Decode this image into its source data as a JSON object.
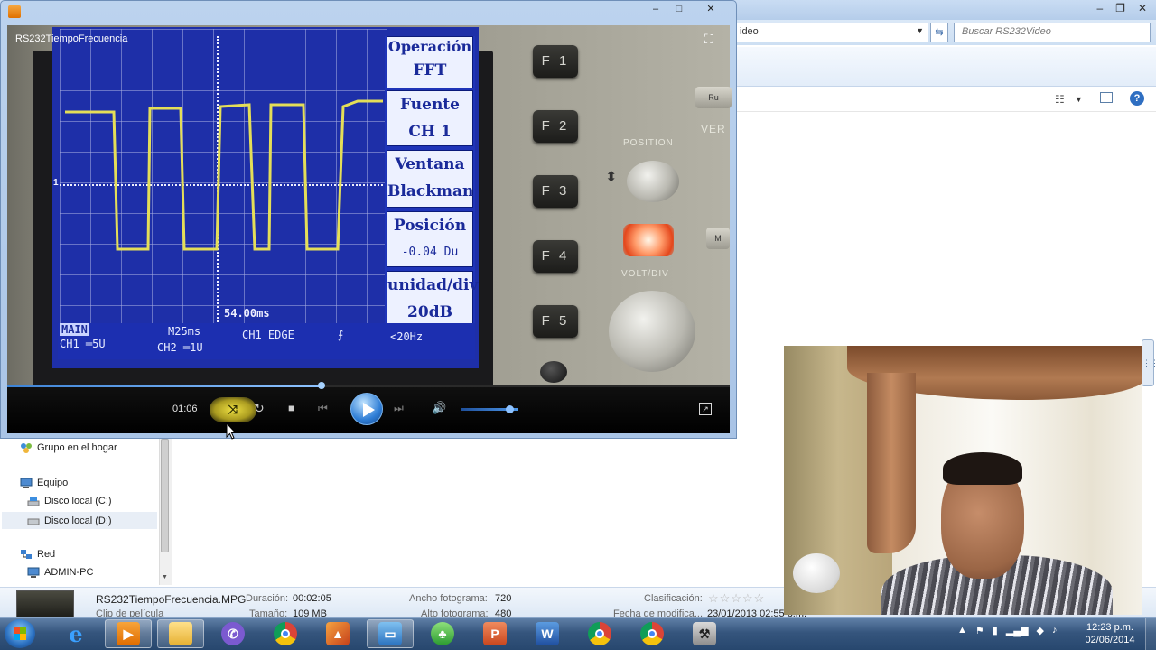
{
  "explorer": {
    "address_text": "ideo",
    "search_placeholder": "Buscar RS232Video",
    "nav": {
      "homegroup": "Grupo en el hogar",
      "computer": "Equipo",
      "disk_c": "Disco local (C:)",
      "disk_d": "Disco local (D:)",
      "network": "Red",
      "admin_pc": "ADMIN-PC"
    },
    "details": {
      "file_name": "RS232TiempoFrecuencia.MPG",
      "file_type": "Clip de película",
      "duration_label": "Duración:",
      "duration_value": "00:02:05",
      "size_label": "Tamaño:",
      "size_value": "109 MB",
      "frame_width_label": "Ancho fotograma:",
      "frame_width_value": "720",
      "frame_height_label": "Alto fotograma:",
      "frame_height_value": "480",
      "rating_label": "Clasificación:",
      "rating_stars": "☆☆☆☆☆",
      "modified_label": "Fecha de modifica...",
      "modified_value": "23/01/2013 02:55 p.m."
    }
  },
  "player": {
    "title": "RS232TiempoFrecuencia",
    "current_time": "01:06",
    "progress_fraction": 0.53,
    "volume_fraction": 0.85
  },
  "scope": {
    "menu": [
      {
        "line1": "Operación",
        "line2": "FFT"
      },
      {
        "line1": "Fuente",
        "line2": "CH 1"
      },
      {
        "line1": "Ventana",
        "line2": "Blackman"
      },
      {
        "line1": "Posición",
        "line2": "-0.04 Du"
      },
      {
        "line1": "unidad/div",
        "line2": "20dB"
      }
    ],
    "trigger_time": "54.00ms",
    "ch1_marker": "1",
    "status": {
      "main": "MAIN",
      "ch1": "CH1 ═5U",
      "timebase": "M25ms",
      "ch2": "CH2 ═1U",
      "trigger": "CH1  EDGE",
      "slope": "⨍",
      "freq": "<20Hz"
    },
    "fkeys": [
      "F 1",
      "F 2",
      "F 3",
      "F 4",
      "F 5"
    ],
    "labels": {
      "position": "POSITION",
      "volts_div": "VOLT/DIV",
      "ver": "VER",
      "run": "Ru",
      "side": "M"
    }
  },
  "taskbar": {
    "clock_time": "12:23 p.m.",
    "clock_date": "02/06/2014"
  },
  "colors": {
    "scope_screen": "#1e2fa8",
    "waveform": "#e8e25a",
    "progress": "#5aa2f0",
    "shuffle_highlight": "#f2e04a"
  }
}
